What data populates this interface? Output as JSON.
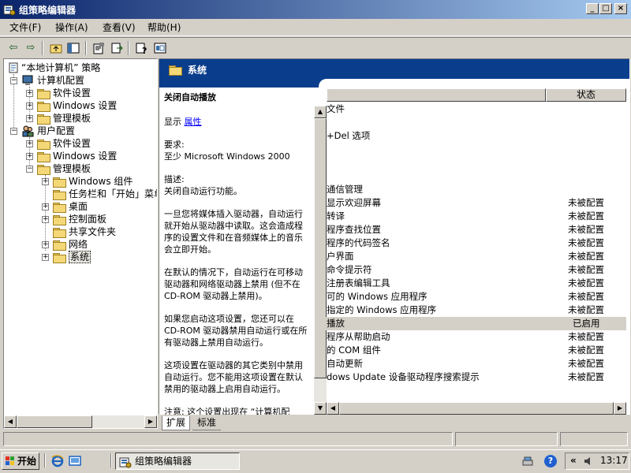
{
  "window": {
    "title": "组策略编辑器",
    "controls": {
      "minimize": "_",
      "maximize": "□",
      "close": "×"
    }
  },
  "menu": [
    {
      "label": "文件(F)"
    },
    {
      "label": "操作(A)"
    },
    {
      "label": "查看(V)"
    },
    {
      "label": "帮助(H)"
    }
  ],
  "toolbar": {
    "icons": [
      "back-arrow-icon",
      "forward-arrow-icon",
      "up-folder-icon",
      "show-hide-tree-icon",
      "properties-icon",
      "export-list-icon",
      "help-icon",
      "mmc-icon"
    ],
    "glyphs": {
      "back": "⇦",
      "forward": "⇨",
      "up": "↑",
      "tree": "▦",
      "props": "☰",
      "export": "⇥",
      "help": "?",
      "mmc": "▣"
    }
  },
  "tree": {
    "root": "“本地计算机” 策略",
    "items": [
      {
        "label": "计算机配置"
      },
      {
        "label": "软件设置"
      },
      {
        "label": "Windows 设置"
      },
      {
        "label": "管理模板"
      },
      {
        "label": "用户配置"
      },
      {
        "label": "软件设置"
      },
      {
        "label": "Windows 设置"
      },
      {
        "label": "管理模板"
      },
      {
        "label": "Windows 组件"
      },
      {
        "label": "任务栏和「开始」菜单"
      },
      {
        "label": "桌面"
      },
      {
        "label": "控制面板"
      },
      {
        "label": "共享文件夹"
      },
      {
        "label": "网络"
      },
      {
        "label": "系统"
      }
    ],
    "expander_plus": "+",
    "expander_minus": "−"
  },
  "header": {
    "title": "系统"
  },
  "description": {
    "setting_title": "关闭自动播放",
    "show_label": "显示",
    "properties_link": "属性",
    "requirements_label": "要求:",
    "requirements_value": "至少 Microsoft Windows 2000",
    "desc_label": "描述:",
    "desc_p1": "关闭自动运行功能。",
    "desc_p2": "一旦您将媒体插入驱动器，自动运行就开始从驱动器中读取。这会造成程序的设置文件和在音频媒体上的音乐会立即开始。",
    "desc_p3": "在默认的情况下，自动运行在可移动驱动器和网络驱动器上禁用 (但不在 CD-ROM 驱动器上禁用)。",
    "desc_p4": "如果您启动这项设置，您还可以在 CD-ROM 驱动器禁用自动运行或在所有驱动器上禁用自动运行。",
    "desc_p5": "这项设置在驱动器的其它类别中禁用自动运行。您不能用这项设置在默认禁用的驱动器上启用自动运行。",
    "desc_p6": "注意: 这个设置出现在 “计算机配"
  },
  "list": {
    "column_status": "状态",
    "rows": [
      {
        "name": "文件",
        "status": ""
      },
      {
        "name": "+Del 选项",
        "status": ""
      },
      {
        "name": "通信管理",
        "status": ""
      },
      {
        "name": "显示欢迎屏幕",
        "status": "未被配置"
      },
      {
        "name": "转译",
        "status": "未被配置"
      },
      {
        "name": "程序查找位置",
        "status": "未被配置"
      },
      {
        "name": "程序的代码签名",
        "status": "未被配置"
      },
      {
        "name": "户界面",
        "status": "未被配置"
      },
      {
        "name": "命令提示符",
        "status": "未被配置"
      },
      {
        "name": "注册表编辑工具",
        "status": "未被配置"
      },
      {
        "name": "可的 Windows 应用程序",
        "status": "未被配置"
      },
      {
        "name": "指定的 Windows 应用程序",
        "status": "未被配置"
      },
      {
        "name": "播放",
        "status": "已启用"
      },
      {
        "name": "程序从帮助启动",
        "status": "未被配置"
      },
      {
        "name": "的 COM 组件",
        "status": "未被配置"
      },
      {
        "name": "自动更新",
        "status": "未被配置"
      },
      {
        "name": "dows Update 设备驱动程序搜索提示",
        "status": "未被配置"
      }
    ]
  },
  "tabs": [
    {
      "label": "扩展"
    },
    {
      "label": "标准"
    }
  ],
  "taskbar": {
    "start_label": "开始",
    "task_label": "组策略编辑器",
    "clock": "13:17",
    "tray_chevron": "«",
    "help_icon": "?"
  },
  "colors": {
    "title_start": "#0a246a",
    "title_end": "#a6caf0",
    "selected_row": "#d4d0c8",
    "link": "#0000ff"
  }
}
